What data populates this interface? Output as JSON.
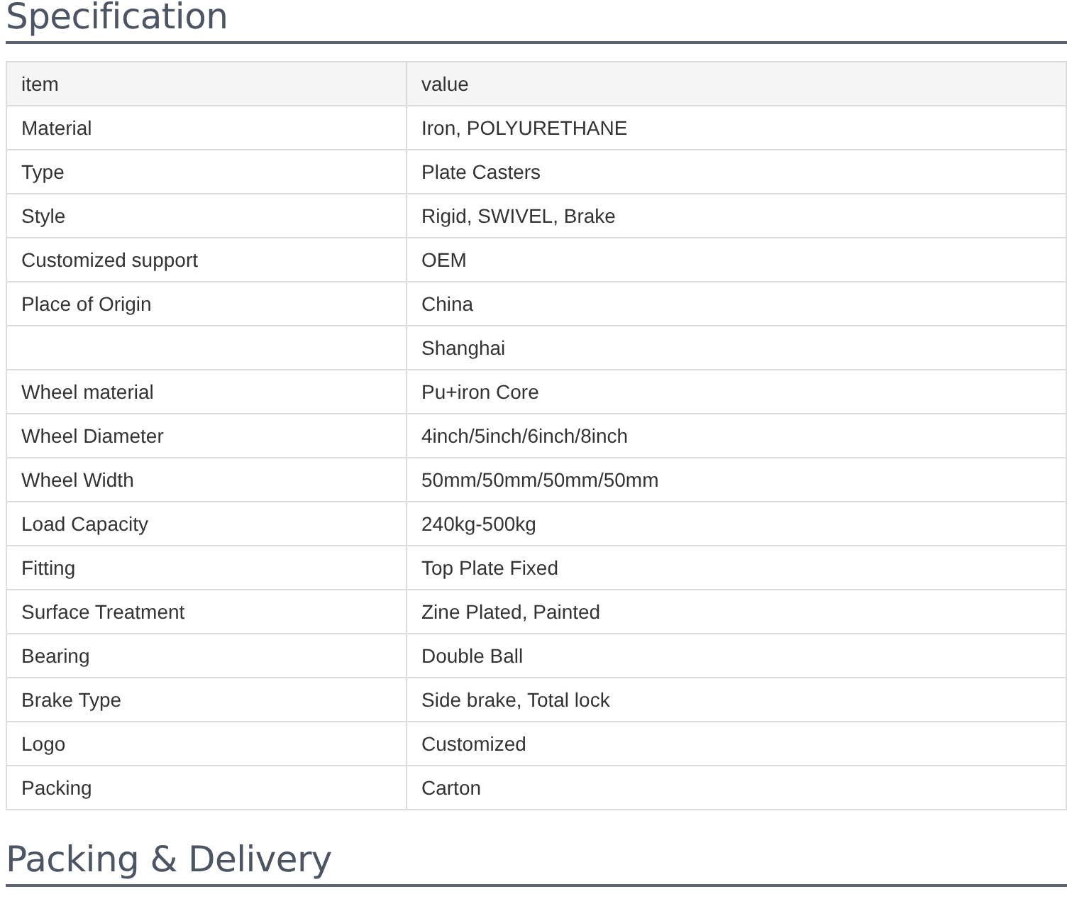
{
  "sections": [
    {
      "title": "Specification"
    },
    {
      "title": "Packing & Delivery"
    }
  ],
  "table": {
    "columns": [
      "item",
      "value"
    ],
    "rows": [
      [
        "Material",
        "Iron, POLYURETHANE"
      ],
      [
        "Type",
        "Plate Casters"
      ],
      [
        "Style",
        "Rigid, SWIVEL, Brake"
      ],
      [
        "Customized support",
        "OEM"
      ],
      [
        "Place of Origin",
        "China"
      ],
      [
        "",
        "Shanghai"
      ],
      [
        "Wheel material",
        "Pu+iron Core"
      ],
      [
        "Wheel Diameter",
        "4inch/5inch/6inch/8inch"
      ],
      [
        "Wheel Width",
        "50mm/50mm/50mm/50mm"
      ],
      [
        "Load Capacity",
        "240kg-500kg"
      ],
      [
        "Fitting",
        "Top Plate Fixed"
      ],
      [
        "Surface Treatment",
        "Zine Plated, Painted"
      ],
      [
        "Bearing",
        "Double Ball"
      ],
      [
        "Brake Type",
        "Side brake, Total lock"
      ],
      [
        "Logo",
        "Customized"
      ],
      [
        "Packing",
        "Carton"
      ]
    ]
  }
}
